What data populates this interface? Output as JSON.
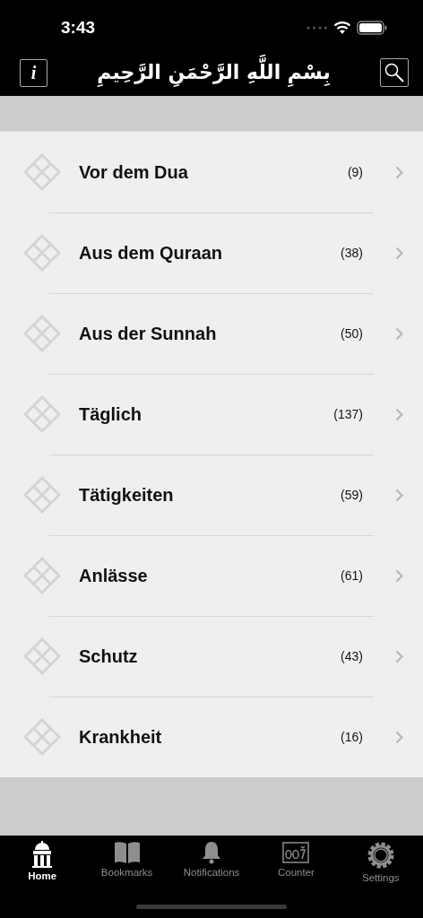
{
  "status_bar": {
    "time": "3:43"
  },
  "header": {
    "title": "بِسْمِ اللَّهِ الرَّحْمَنِ الرَّحِيمِ",
    "info_label": "i"
  },
  "categories": [
    {
      "name": "Vor dem Dua",
      "count": "(9)"
    },
    {
      "name": "Aus dem Quraan",
      "count": "(38)"
    },
    {
      "name": "Aus der Sunnah",
      "count": "(50)"
    },
    {
      "name": "Täglich",
      "count": "(137)"
    },
    {
      "name": "Tätigkeiten",
      "count": "(59)"
    },
    {
      "name": "Anlässe",
      "count": "(61)"
    },
    {
      "name": "Schutz",
      "count": "(43)"
    },
    {
      "name": "Krankheit",
      "count": "(16)"
    }
  ],
  "tab_bar": [
    {
      "kind": "home",
      "label": "Home",
      "selected": true
    },
    {
      "kind": "bookmarks",
      "label": "Bookmarks",
      "selected": false
    },
    {
      "kind": "notifications",
      "label": "Notifications",
      "selected": false
    },
    {
      "kind": "counter",
      "label": "Counter",
      "selected": false
    },
    {
      "kind": "settings",
      "label": "Settings",
      "selected": false
    }
  ]
}
